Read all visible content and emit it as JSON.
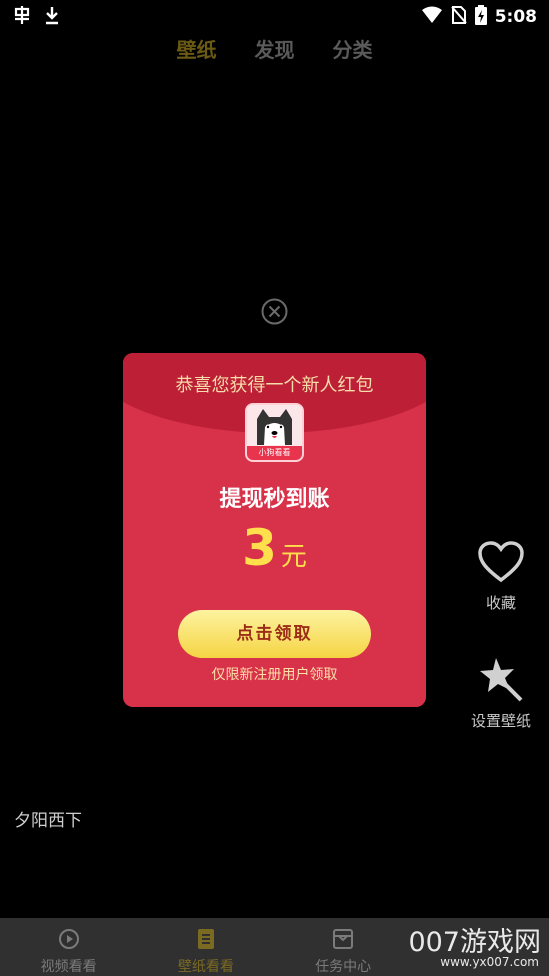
{
  "status_bar": {
    "time": "5:08",
    "left_icons": [
      "app-notification-icon",
      "download-icon"
    ],
    "right_icons": [
      "wifi-icon",
      "no-sim-icon",
      "battery-charging-icon"
    ]
  },
  "top_tabs": [
    {
      "label": "壁纸",
      "active": true
    },
    {
      "label": "发现",
      "active": false
    },
    {
      "label": "分类",
      "active": false
    }
  ],
  "side_actions": {
    "favorite_label": "收藏",
    "set_wallpaper_label": "设置壁纸"
  },
  "wallpaper": {
    "title": "夕阳西下"
  },
  "bottom_nav": [
    {
      "label": "视频看看",
      "icon": "play-circle-icon",
      "active": false
    },
    {
      "label": "壁纸看看",
      "icon": "document-icon",
      "active": true
    },
    {
      "label": "任务中心",
      "icon": "task-box-icon",
      "active": false
    }
  ],
  "popup": {
    "header": "恭喜您获得一个新人红包",
    "app_icon_caption": "小狗看看",
    "subtitle": "提现秒到账",
    "amount": "3",
    "amount_unit": "元",
    "claim_button": "点击领取",
    "note": "仅限新注册用户领取"
  },
  "watermark": {
    "text": "007游戏网",
    "url_text": "www.yx007.com"
  },
  "colors": {
    "background": "#000000",
    "popup_red": "#d8314a",
    "popup_dark_red": "#bd1f37",
    "amount_yellow": "#ffe04c",
    "button_yellow": "#f5d443",
    "active_tab": "#6b5a14"
  }
}
